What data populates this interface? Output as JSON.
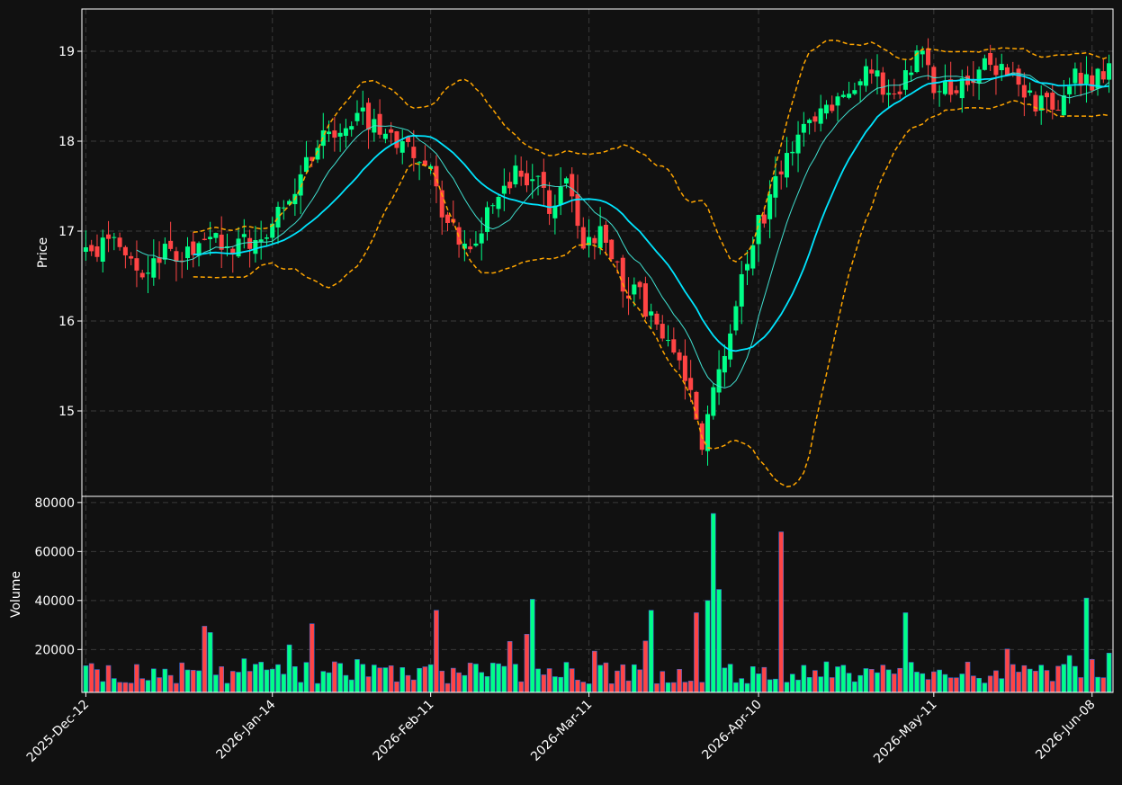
{
  "chart_data": [
    {
      "type": "candlestick",
      "panel": "price",
      "ylabel": "Price",
      "ylim": [
        14.05,
        19.47
      ],
      "yticks": [
        15,
        16,
        17,
        18,
        19
      ],
      "grid": true,
      "x_range": [
        "2025-12-12",
        "2026-06-11"
      ],
      "xticks": [
        "2025-Dec-12",
        "2026-Jan-14",
        "2026-Feb-11",
        "2026-Mar-11",
        "2026-Apr-10",
        "2026-May-11",
        "2026-Jun-08"
      ],
      "colors": {
        "up": "#00ff88",
        "down": "#ff4444",
        "ma_fast": "#40e0d0",
        "ma_slow": "#00e5ff",
        "bollinger": "#ffa500",
        "background": "#111111",
        "grid": "#3a3a3a"
      },
      "close_anchors": [
        [
          "2025-12-12",
          16.78
        ],
        [
          "2025-12-17",
          16.82
        ],
        [
          "2025-12-22",
          16.6
        ],
        [
          "2025-12-26",
          16.72
        ],
        [
          "2026-01-01",
          16.85
        ],
        [
          "2026-01-06",
          16.9
        ],
        [
          "2026-01-12",
          16.82
        ],
        [
          "2026-01-16",
          17.35
        ],
        [
          "2026-01-20",
          17.75
        ],
        [
          "2026-01-25",
          18.15
        ],
        [
          "2026-01-29",
          18.35
        ],
        [
          "2026-02-02",
          18.05
        ],
        [
          "2026-02-06",
          17.95
        ],
        [
          "2026-02-10",
          17.8
        ],
        [
          "2026-02-14",
          17.05
        ],
        [
          "2026-02-18",
          16.85
        ],
        [
          "2026-02-22",
          17.25
        ],
        [
          "2026-02-26",
          17.6
        ],
        [
          "2026-03-02",
          17.55
        ],
        [
          "2026-03-05",
          17.2
        ],
        [
          "2026-03-07",
          17.6
        ],
        [
          "2026-03-10",
          16.8
        ],
        [
          "2026-03-13",
          16.95
        ],
        [
          "2026-03-17",
          16.45
        ],
        [
          "2026-03-20",
          16.25
        ],
        [
          "2026-03-23",
          15.85
        ],
        [
          "2026-03-27",
          15.55
        ],
        [
          "2026-03-31",
          14.65
        ],
        [
          "2026-04-02",
          15.2
        ],
        [
          "2026-04-04",
          15.5
        ],
        [
          "2026-04-06",
          16.1
        ],
        [
          "2026-04-08",
          16.75
        ],
        [
          "2026-04-13",
          17.5
        ],
        [
          "2026-04-17",
          18.0
        ],
        [
          "2026-04-22",
          18.4
        ],
        [
          "2026-04-26",
          18.55
        ],
        [
          "2026-04-30",
          18.8
        ],
        [
          "2026-05-04",
          18.5
        ],
        [
          "2026-05-08",
          19.0
        ],
        [
          "2026-05-12",
          18.55
        ],
        [
          "2026-05-16",
          18.7
        ],
        [
          "2026-05-20",
          18.85
        ],
        [
          "2026-05-24",
          18.7
        ],
        [
          "2026-05-28",
          18.5
        ],
        [
          "2026-06-01",
          18.3
        ],
        [
          "2026-06-05",
          18.75
        ],
        [
          "2026-06-08",
          18.65
        ],
        [
          "2026-06-11",
          18.85
        ]
      ],
      "series": [
        {
          "indicator": "sma-short",
          "window": 10,
          "color": "#40e0d0"
        },
        {
          "indicator": "sma-long",
          "window": 20,
          "color": "#00e5ff"
        },
        {
          "indicator": "bollinger",
          "window": 20,
          "k": 2,
          "color": "#ffa500"
        }
      ]
    },
    {
      "type": "bar",
      "panel": "volume",
      "ylabel": "Volume",
      "ylim": [
        2500,
        82500
      ],
      "yticks": [
        "20000",
        "40000",
        "60000",
        "80000"
      ],
      "grid": true,
      "volume_anchors": [
        [
          "2026-03-22",
          36000
        ],
        [
          "2026-03-30",
          35000
        ],
        [
          "2026-04-01",
          40000
        ],
        [
          "2026-04-02",
          75500
        ],
        [
          "2026-04-03",
          44500
        ],
        [
          "2026-04-14",
          68000
        ],
        [
          "2026-05-06",
          35000
        ],
        [
          "2026-06-07",
          41000
        ],
        [
          "2026-02-12",
          36000
        ],
        [
          "2026-03-01",
          40500
        ],
        [
          "2026-01-02",
          29500
        ],
        [
          "2026-01-21",
          30500
        ]
      ]
    }
  ]
}
